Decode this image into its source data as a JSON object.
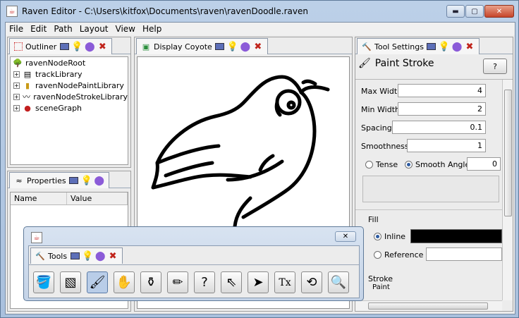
{
  "window": {
    "title": "Raven Editor - C:\\Users\\kitfox\\Documents\\raven\\ravenDoodle.raven"
  },
  "menu": [
    "File",
    "Edit",
    "Path",
    "Layout",
    "View",
    "Help"
  ],
  "outliner": {
    "tab": "Outliner",
    "nodes": [
      {
        "label": "ravenNodeRoot",
        "icon": "tree-icon",
        "expander": ""
      },
      {
        "label": "trackLibrary",
        "icon": "film-icon",
        "expander": "+"
      },
      {
        "label": "ravenNodePaintLibrary",
        "icon": "paint-can-icon",
        "expander": "+"
      },
      {
        "label": "ravenNodeStrokeLibrary",
        "icon": "stroke-icon",
        "expander": "+"
      },
      {
        "label": "sceneGraph",
        "icon": "dot-icon",
        "expander": "+"
      }
    ]
  },
  "properties": {
    "tab": "Properties",
    "columns": [
      "Name",
      "Value"
    ]
  },
  "display": {
    "tab": "Display Coyote"
  },
  "tool_settings": {
    "tab": "Tool Settings",
    "heading": "Paint Stroke",
    "help": "?",
    "max_width_label": "Max Width",
    "max_width": "4",
    "min_width_label": "Min Width",
    "min_width": "2",
    "spacing_label": "Spacing",
    "spacing": "0.1",
    "smoothness_label": "Smoothness",
    "smoothness": "1",
    "tense_label": "Tense",
    "smooth_angle_label": "Smooth Angle",
    "smooth_angle": "0",
    "fill_label": "Fill",
    "inline_label": "Inline",
    "reference_label": "Reference",
    "stroke_label": "Stroke",
    "paint_label": "Paint"
  },
  "tools": {
    "tab": "Tools",
    "close": "✕",
    "buttons": [
      {
        "name": "paint-bucket-tool-icon",
        "glyph": "🪣"
      },
      {
        "name": "gradient-tool-icon",
        "glyph": "▧"
      },
      {
        "name": "paint-brush-tool-icon",
        "glyph": "🖌"
      },
      {
        "name": "pan-hand-tool-icon",
        "glyph": "✋"
      },
      {
        "name": "ink-bottle-tool-icon",
        "glyph": "⚱"
      },
      {
        "name": "pencil-tool-icon",
        "glyph": "✏"
      },
      {
        "name": "help-tool-icon",
        "glyph": "?"
      },
      {
        "name": "select-arrow-tool-icon",
        "glyph": "⇖"
      },
      {
        "name": "direct-select-arrow-tool-icon",
        "glyph": "➤"
      },
      {
        "name": "text-tool-icon",
        "glyph": "Tx"
      },
      {
        "name": "rotate-tool-icon",
        "glyph": "⟲"
      },
      {
        "name": "zoom-tool-icon",
        "glyph": "🔍"
      }
    ]
  },
  "colors": {
    "fill_inline": "#000000",
    "active_tool": "#b9cde8",
    "accent_red": "#c0241b"
  }
}
